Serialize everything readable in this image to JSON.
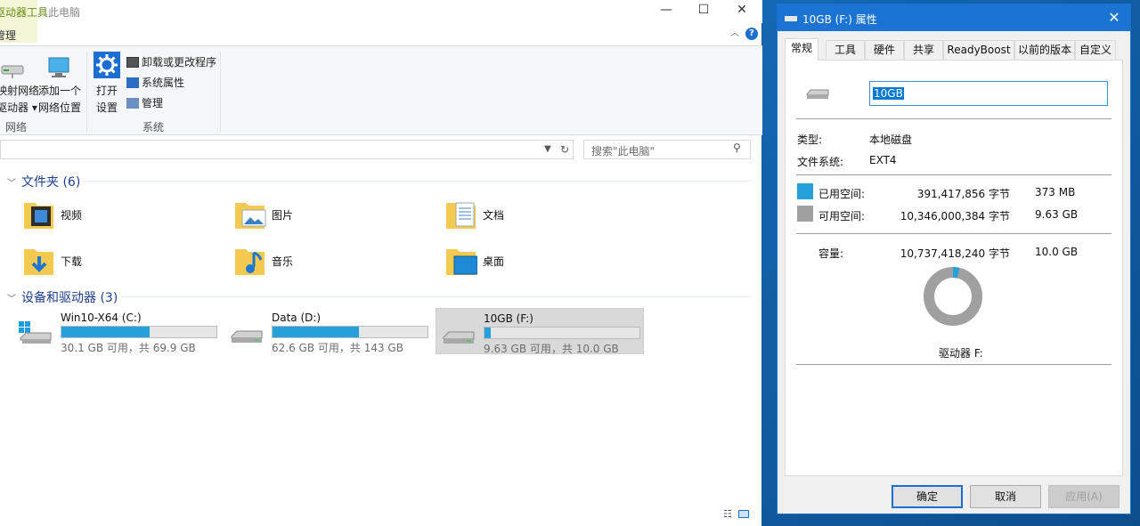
{
  "explorer": {
    "context_tab": {
      "group": "驱动器工具",
      "tab": "管理"
    },
    "title": "此电脑",
    "controls": {
      "minimize": "—",
      "maximize": "☐",
      "close": "✕"
    },
    "ribbon": {
      "map_drive": {
        "line1": "映射网络",
        "line2": "驱动器 ▾"
      },
      "add_location": {
        "line1": "添加一个",
        "line2": "网络位置"
      },
      "open_settings": {
        "line1": "打开",
        "line2": "设置"
      },
      "uninstall": "卸载或更改程序",
      "sys_props": "系统属性",
      "manage": "管理",
      "group_network": "网络",
      "group_system": "系统"
    },
    "search": {
      "placeholder": "搜索\"此电脑\""
    },
    "folders_header": "文件夹 (6)",
    "folders": [
      {
        "label": "视频",
        "icon": "video-folder-icon"
      },
      {
        "label": "图片",
        "icon": "pictures-folder-icon"
      },
      {
        "label": "文档",
        "icon": "documents-folder-icon"
      },
      {
        "label": "下载",
        "icon": "downloads-folder-icon"
      },
      {
        "label": "音乐",
        "icon": "music-folder-icon"
      },
      {
        "label": "桌面",
        "icon": "desktop-folder-icon"
      }
    ],
    "drives_header": "设备和驱动器 (3)",
    "drives": [
      {
        "name": "Win10-X64 (C:)",
        "info": "30.1 GB 可用，共 69.9 GB",
        "used_fraction": 0.57,
        "icon": "windows-drive-icon"
      },
      {
        "name": "Data (D:)",
        "info": "62.6 GB 可用，共 143 GB",
        "used_fraction": 0.56,
        "icon": "drive-icon"
      },
      {
        "name": "10GB (F:)",
        "info": "9.63 GB 可用，共 10.0 GB",
        "used_fraction": 0.04,
        "icon": "drive-icon"
      }
    ]
  },
  "dialog": {
    "title": "10GB (F:) 属性",
    "tabs": [
      "常规",
      "工具",
      "硬件",
      "共享",
      "ReadyBoost",
      "以前的版本",
      "自定义"
    ],
    "active_tab": "常规",
    "name_value": "10GB",
    "type_label": "类型:",
    "type_value": "本地磁盘",
    "fs_label": "文件系统:",
    "fs_value": "EXT4",
    "used_label": "已用空间:",
    "used_bytes": "391,417,856 字节",
    "used_size": "373 MB",
    "free_label": "可用空间:",
    "free_bytes": "10,346,000,384 字节",
    "free_size": "9.63 GB",
    "cap_label": "容量:",
    "cap_bytes": "10,737,418,240 字节",
    "cap_size": "10.0 GB",
    "drive_label": "驱动器 F:",
    "used_fraction": 0.036,
    "colors": {
      "used": "#26a0da",
      "free": "#a0a0a0"
    },
    "buttons": {
      "ok": "确定",
      "cancel": "取消",
      "apply": "应用(A)"
    }
  }
}
